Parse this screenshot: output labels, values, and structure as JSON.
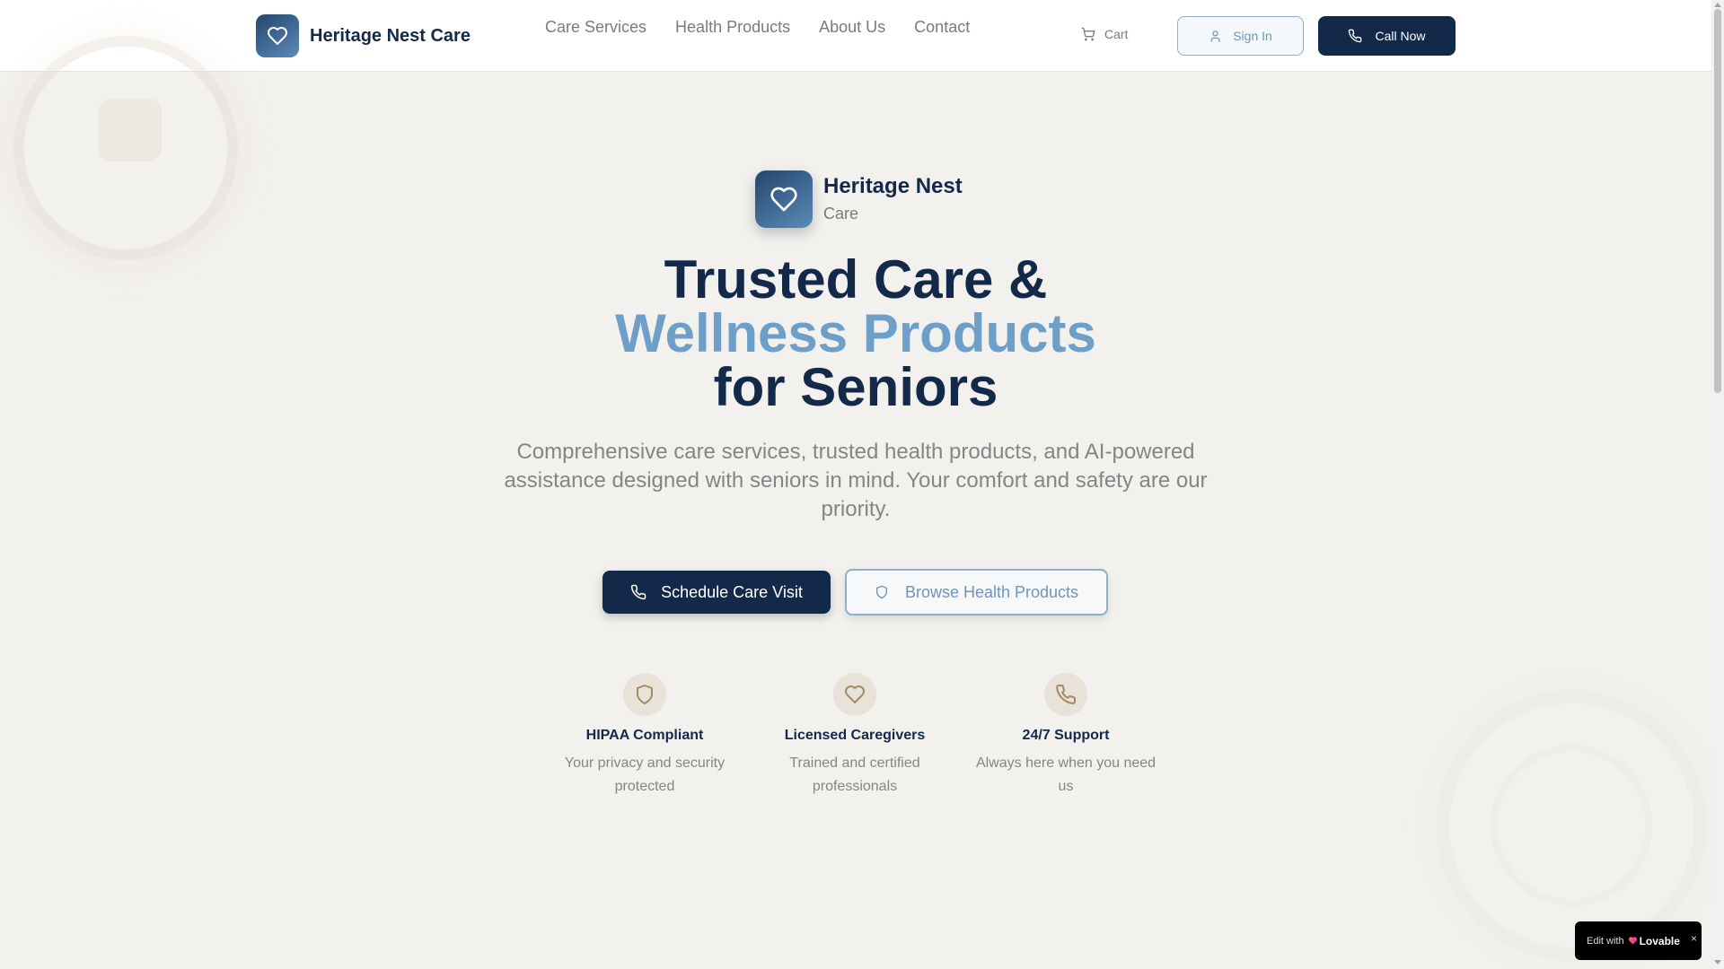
{
  "header": {
    "brand_name": "Heritage Nest Care",
    "nav": [
      "Care Services",
      "Health Products",
      "About Us",
      "Contact"
    ],
    "cart_label": "Cart",
    "signin_label": "Sign In",
    "call_label": "Call Now"
  },
  "hero": {
    "brand_name": "Heritage Nest",
    "brand_sub": "Care",
    "headline_line1": "Trusted Care &",
    "headline_line2": "Wellness Products",
    "headline_line3": "for Seniors",
    "subtext": "Comprehensive care services, trusted health products, and AI-powered assistance designed with seniors in mind. Your comfort and safety are our priority.",
    "cta_primary": "Schedule Care Visit",
    "cta_secondary": "Browse Health Products"
  },
  "features": [
    {
      "title": "HIPAA Compliant",
      "desc": "Your privacy and security protected",
      "icon": "shield-icon"
    },
    {
      "title": "Licensed Caregivers",
      "desc": "Trained and certified professionals",
      "icon": "heart-icon"
    },
    {
      "title": "24/7 Support",
      "desc": "Always here when you need us",
      "icon": "phone-icon"
    }
  ],
  "badge": {
    "text": "Edit with",
    "brand": "Lovable",
    "close": "×"
  },
  "colors": {
    "navy": "#13294a",
    "accent": "#6d9fc8",
    "background": "#f3f1ed",
    "feature_icon_bg": "#e8e2d8"
  }
}
